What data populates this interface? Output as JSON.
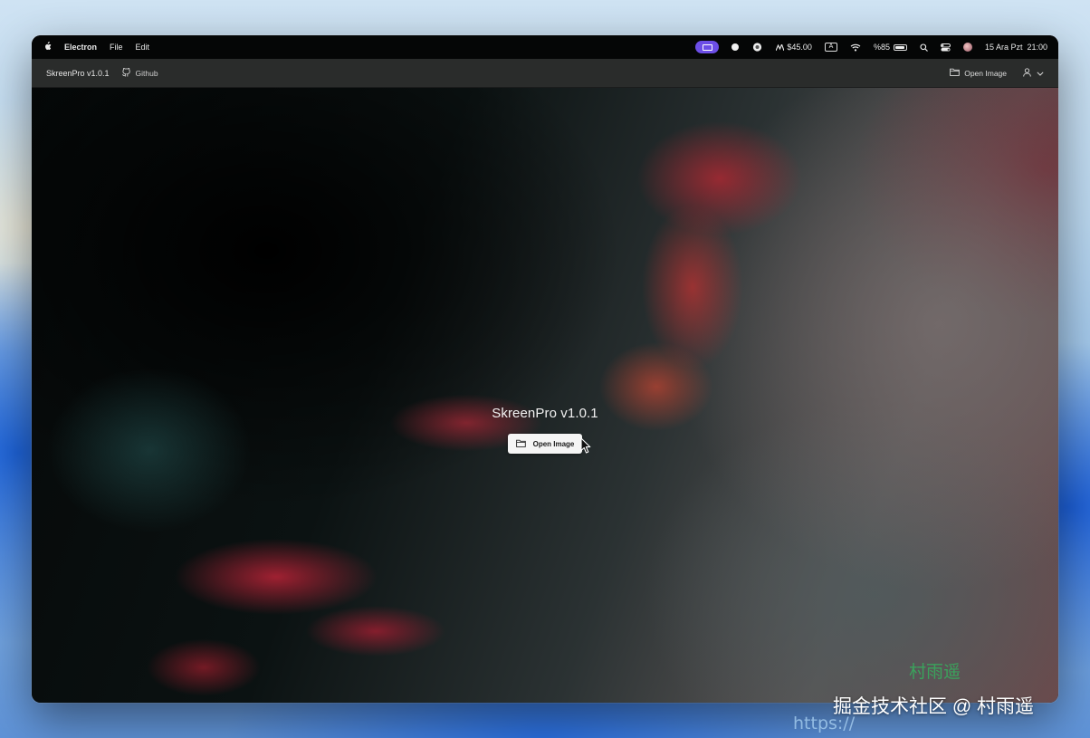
{
  "menubar": {
    "app_name": "Electron",
    "menus": [
      "File",
      "Edit"
    ],
    "status_price": "$45.00",
    "input_source": "A",
    "battery": "%85",
    "date_time": "15 Ara Pzt  21:00"
  },
  "toolbar": {
    "brand": "SkreenPro v1.0.1",
    "github": "Github",
    "open_image": "Open Image"
  },
  "main": {
    "title": "SkreenPro v1.0.1",
    "open_image_button": "Open Image"
  },
  "watermark": {
    "author": "村雨遥",
    "community": "掘金技术社区 @ 村雨遥",
    "url": "https://"
  },
  "colors": {
    "accent_pill": "#6c4ee6",
    "toolbar_bg": "#2a2c2b",
    "menubar_bg": "#050606"
  }
}
